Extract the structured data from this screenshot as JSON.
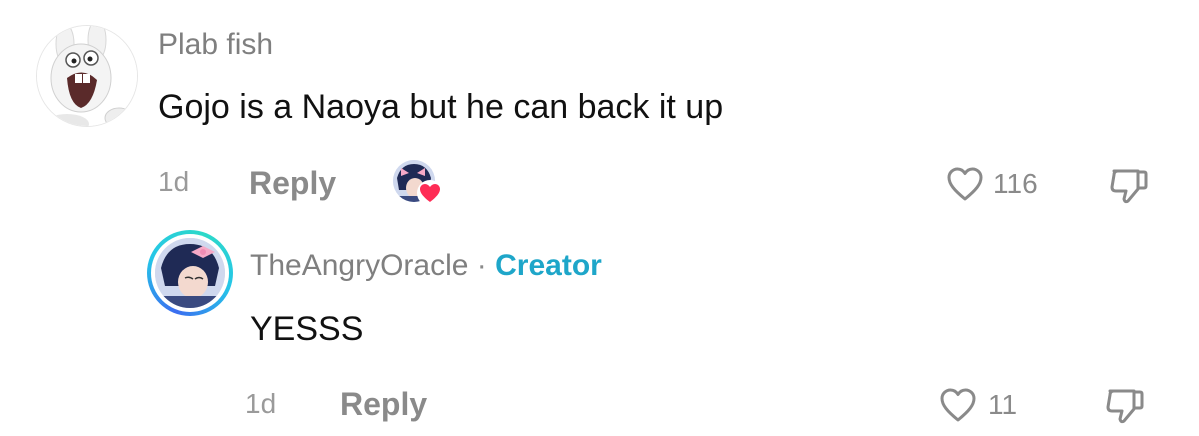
{
  "comments": [
    {
      "username": "Plab fish",
      "text": "Gojo is a Naoya but he can back it up",
      "time": "1d",
      "reply_label": "Reply",
      "likes": "116"
    }
  ],
  "reply": {
    "username": "TheAngryOracle",
    "separator": "·",
    "creator_label": "Creator",
    "text": "YESSS",
    "time": "1d",
    "reply_label": "Reply",
    "likes": "11"
  },
  "icons": {
    "like": "heart-outline-icon",
    "dislike": "thumbs-down-icon",
    "creator_liked": "creator-liked-heart-icon"
  },
  "colors": {
    "creator_accent": "#1ea6c9",
    "heart_badge": "#fe2c55",
    "muted_text": "#8a8a8a"
  }
}
